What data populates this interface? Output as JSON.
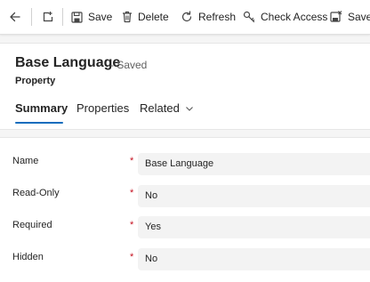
{
  "toolbar": {
    "back_label": "Back",
    "open_new_window_label": "Open in new window",
    "save_label": "Save",
    "delete_label": "Delete",
    "refresh_label": "Refresh",
    "check_access_label": "Check Access",
    "save_and_close_label": "Save &"
  },
  "header": {
    "title": "Base Language",
    "status": "- Saved",
    "entity_type": "Property",
    "tabs": [
      {
        "label": "Summary",
        "active": true
      },
      {
        "label": "Properties",
        "active": false
      },
      {
        "label": "Related",
        "active": false
      }
    ]
  },
  "form": {
    "required_marker": "*",
    "fields": [
      {
        "label": "Name",
        "value": "Base Language"
      },
      {
        "label": "Read-Only",
        "value": "No"
      },
      {
        "label": "Required",
        "value": "Yes"
      },
      {
        "label": "Hidden",
        "value": "No"
      }
    ]
  },
  "colors": {
    "accent": "#0f6cbd",
    "required": "#c50f1f",
    "field_bg": "#f3f3f3",
    "page_bg": "#f5f5f5"
  }
}
